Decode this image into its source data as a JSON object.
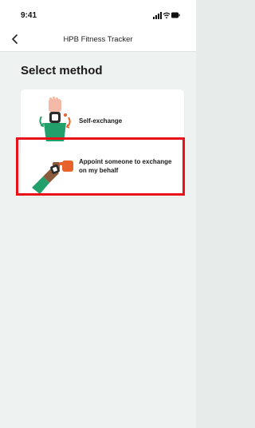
{
  "status_bar": {
    "time": "9:41",
    "icons": [
      "signal-icon",
      "wifi-icon",
      "battery-icon"
    ]
  },
  "nav": {
    "title": "HPB Fitness Tracker",
    "back_icon": "chevron-left-icon"
  },
  "page": {
    "heading": "Select method"
  },
  "options": [
    {
      "label": "Self-exchange",
      "icon": "self-exchange-illustration"
    },
    {
      "label": "Appoint someone to exchange on my behalf",
      "icon": "appoint-someone-illustration"
    }
  ],
  "colors": {
    "background": "#eef2f0",
    "card": "#ffffff",
    "highlight": "#e8111a",
    "accent_green": "#22a06b",
    "accent_orange": "#e8622c"
  }
}
